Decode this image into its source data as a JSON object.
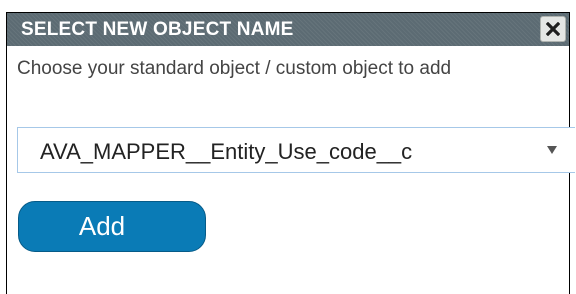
{
  "dialog": {
    "title": "SELECT NEW OBJECT NAME",
    "close_icon": "close-x-icon",
    "description": "Choose your standard object / custom object to add",
    "select": {
      "value": "AVA_MAPPER__Entity_Use_code__c",
      "arrow_icon": "dropdown-arrow-icon"
    },
    "add_label": "Add"
  },
  "colors": {
    "titlebar": "#5c6b73",
    "button": "#0a7bb6",
    "select_border": "#a6c8e8",
    "description_text": "#444444"
  }
}
